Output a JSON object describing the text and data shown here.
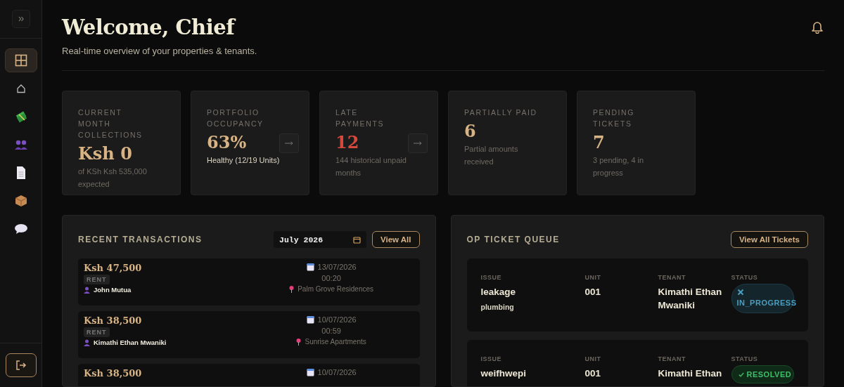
{
  "sidebar": {
    "items": [
      {
        "selected": true
      },
      {
        "selected": false
      },
      {
        "selected": false
      },
      {
        "selected": false
      },
      {
        "selected": false
      },
      {
        "selected": false
      },
      {
        "selected": false
      }
    ]
  },
  "header": {
    "title": "Welcome, Chief",
    "subtitle": "Real-time overview of your properties & tenants."
  },
  "stats": [
    {
      "label": "CURRENT MONTH COLLECTIONS",
      "value": "Ksh 0",
      "note": "of KSh Ksh 535,000 expected",
      "alert": false,
      "note_bright": false,
      "has_link": false
    },
    {
      "label": "PORTFOLIO OCCUPANCY",
      "value": "63%",
      "note": "Healthy (12/19 Units)",
      "alert": false,
      "note_bright": true,
      "has_link": true
    },
    {
      "label": "LATE PAYMENTS",
      "value": "12",
      "note": "144 historical unpaid months",
      "alert": true,
      "note_bright": false,
      "has_link": true
    },
    {
      "label": "PARTIALLY PAID",
      "value": "6",
      "note": "Partial amounts received",
      "alert": false,
      "note_bright": false,
      "has_link": false
    },
    {
      "label": "PENDING TICKETS",
      "value": "7",
      "note": "3 pending, 4 in progress",
      "alert": false,
      "note_bright": false,
      "has_link": false
    }
  ],
  "transactions": {
    "title": "RECENT TRANSACTIONS",
    "month": "July 2026",
    "button": "View All",
    "rows": [
      {
        "amount": "Ksh 47,500",
        "type": "RENT",
        "tenant": "John Mutua",
        "date": "13/07/2026",
        "time": "00:20",
        "property": "Palm Grove Residences"
      },
      {
        "amount": "Ksh 38,500",
        "type": "RENT",
        "tenant": "Kimathi Ethan Mwaniki",
        "date": "10/07/2026",
        "time": "00:59",
        "property": "Sunrise Apartments"
      },
      {
        "amount": "Ksh 38,500",
        "date": "10/07/2026"
      }
    ]
  },
  "tickets": {
    "title": "OP TICKET QUEUE",
    "button": "View All Tickets",
    "rows": [
      {
        "issue_label": "ISSUE",
        "issue": "leakage",
        "category": "plumbing",
        "unit_label": "UNIT",
        "unit": "001",
        "tenant_label": "TENANT",
        "tenant": "Kimathi Ethan Mwaniki",
        "status_label": "STATUS",
        "status": "IN_PROGRESS",
        "resolved": false
      },
      {
        "issue_label": "ISSUE",
        "issue": "weifhwepi",
        "unit_label": "UNIT",
        "unit": "001",
        "tenant_label": "TENANT",
        "tenant": "Kimathi Ethan",
        "status_label": "STATUS",
        "status": "RESOLVED",
        "resolved": true
      }
    ]
  }
}
